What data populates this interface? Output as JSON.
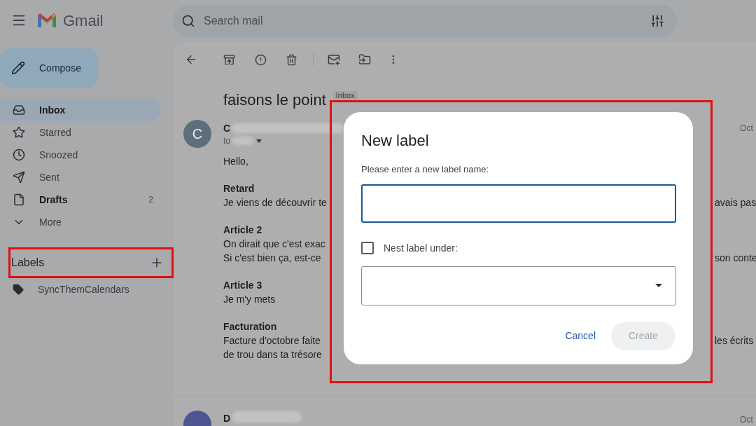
{
  "app": {
    "name": "Gmail"
  },
  "search": {
    "placeholder": "Search mail"
  },
  "compose": {
    "label": "Compose"
  },
  "nav": [
    {
      "kind": "inbox",
      "label": "Inbox",
      "selected": true,
      "unread": true
    },
    {
      "kind": "star",
      "label": "Starred",
      "selected": false,
      "unread": false
    },
    {
      "kind": "clock",
      "label": "Snoozed",
      "selected": false,
      "unread": false
    },
    {
      "kind": "send",
      "label": "Sent",
      "selected": false,
      "unread": false
    },
    {
      "kind": "file",
      "label": "Drafts",
      "selected": false,
      "unread": true,
      "count": "2"
    },
    {
      "kind": "more",
      "label": "More",
      "selected": false,
      "unread": false
    }
  ],
  "labels": {
    "title": "Labels",
    "items": [
      {
        "name": "SyncThemCalendars"
      }
    ]
  },
  "message": {
    "subject": "faisons le point",
    "chip": "Inbox",
    "avatar": "C",
    "sender": "C",
    "to": "to",
    "date": "Oct",
    "greeting": "Hello,",
    "sections": [
      {
        "heading": "Retard",
        "lines": [
          {
            "left": "Je viens de découvrir te",
            "right": "avais pas"
          }
        ]
      },
      {
        "heading": "Article 2",
        "lines": [
          {
            "left": "On dirait que c'est exac"
          },
          {
            "left": "Si c'est bien ça, est-ce",
            "right": "son conte"
          }
        ]
      },
      {
        "heading": "Article 3",
        "lines": [
          {
            "left": "Je m'y mets"
          }
        ]
      },
      {
        "heading": "Facturation",
        "lines": [
          {
            "left": "Facture d'octobre faite",
            "right": "les écrits"
          },
          {
            "left": "de trou dans ta trésore"
          }
        ]
      }
    ]
  },
  "next_message": {
    "sender": "D",
    "date": "Oct"
  },
  "dialog": {
    "title": "New label",
    "prompt": "Please enter a new label name:",
    "nest_label": "Nest label under:",
    "nest_checked": false,
    "cancel": "Cancel",
    "create": "Create",
    "create_disabled": true
  }
}
